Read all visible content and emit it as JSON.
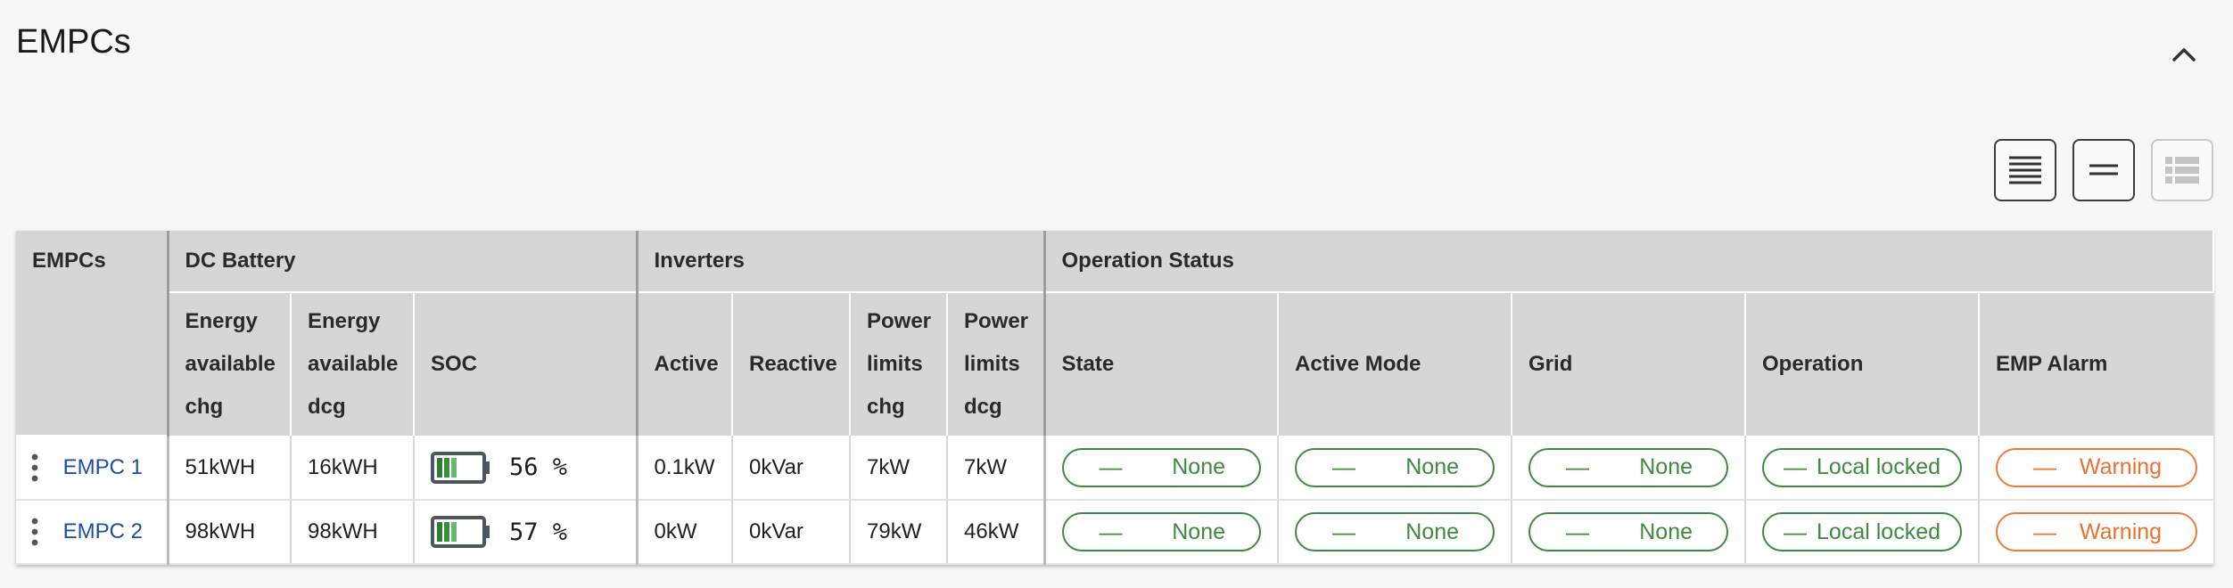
{
  "page": {
    "title": "EMPCs"
  },
  "colors": {
    "ok": "#3f8a3f",
    "warning": "#e8722f",
    "link": "#1c4fa3",
    "header_bg": "#d6d6d6"
  },
  "toolbar": {
    "icons": [
      "collapse-up-icon",
      "view-dense-icon",
      "view-compact-icon",
      "view-list-icon"
    ]
  },
  "table": {
    "groups": {
      "empcs": "EMPCs",
      "dc_battery": "DC Battery",
      "inverters": "Inverters",
      "operation_status": "Operation Status"
    },
    "columns": {
      "energy_chg": "Energy available chg",
      "energy_dcg": "Energy available dcg",
      "soc": "SOC",
      "active": "Active",
      "reactive": "Reactive",
      "power_chg": "Power limits chg",
      "power_dcg": "Power limits dcg",
      "state": "State",
      "active_mode": "Active Mode",
      "grid": "Grid",
      "operation": "Operation",
      "emp_alarm": "EMP Alarm"
    },
    "rows": [
      {
        "name": "EMPC 1",
        "energy_chg": "51kWH",
        "energy_dcg": "16kWH",
        "soc": "56 %",
        "soc_level": 0.56,
        "active": "0.1kW",
        "reactive": "0kVar",
        "power_chg": "7kW",
        "power_dcg": "7kW",
        "state": "None",
        "active_mode": "None",
        "grid": "None",
        "operation": "Local locked",
        "emp_alarm": "Warning"
      },
      {
        "name": "EMPC 2",
        "energy_chg": "98kWH",
        "energy_dcg": "98kWH",
        "soc": "57 %",
        "soc_level": 0.57,
        "active": "0kW",
        "reactive": "0kVar",
        "power_chg": "79kW",
        "power_dcg": "46kW",
        "state": "None",
        "active_mode": "None",
        "grid": "None",
        "operation": "Local locked",
        "emp_alarm": "Warning"
      }
    ]
  }
}
